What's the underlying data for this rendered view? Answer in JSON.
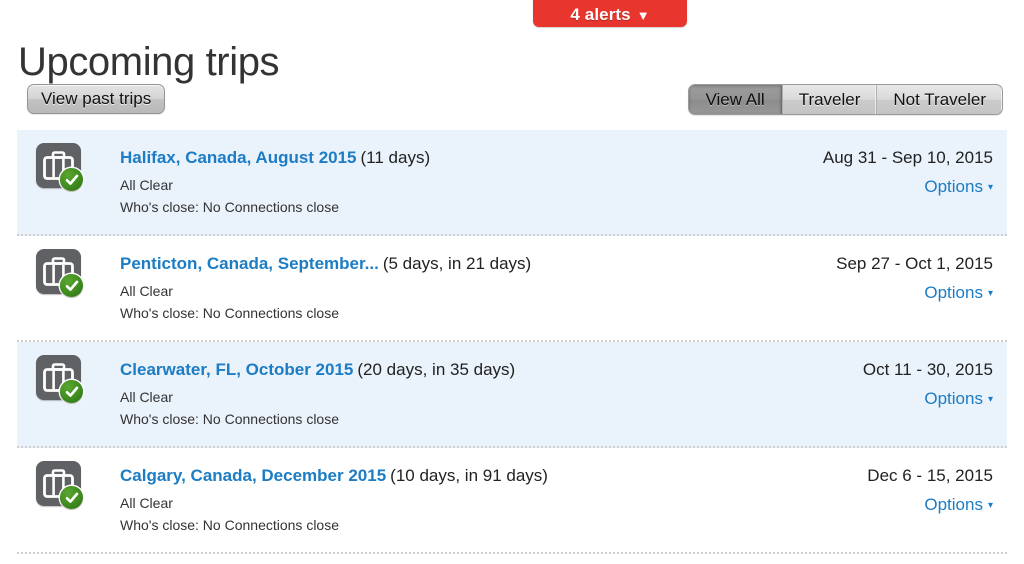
{
  "header": {
    "title": "Upcoming trips",
    "alerts_badge": {
      "label": "4 alerts",
      "caret": "▼",
      "color": "#e8362f"
    },
    "view_past_trips_label": "View past trips",
    "filters": {
      "selected": "View All",
      "options": [
        "View All",
        "Traveler",
        "Not Traveler"
      ]
    }
  },
  "trips": [
    {
      "title": "Halifax, Canada, August 2015",
      "duration": "(11 days)",
      "status": "All Clear",
      "whos_close": "Who's close: No Connections close",
      "dates": "Aug 31 - Sep 10, 2015",
      "options_label": "Options",
      "options_caret": "▾",
      "icon": "briefcase-icon",
      "badge": "green-check-icon",
      "shaded": true
    },
    {
      "title": "Penticton, Canada, September...",
      "duration": "(5 days, in 21 days)",
      "status": "All Clear",
      "whos_close": "Who's close: No Connections close",
      "dates": "Sep 27 - Oct 1, 2015",
      "options_label": "Options",
      "options_caret": "▾",
      "icon": "briefcase-icon",
      "badge": "green-check-icon",
      "shaded": false
    },
    {
      "title": "Clearwater, FL, October 2015",
      "duration": "(20 days, in 35 days)",
      "status": "All Clear",
      "whos_close": "Who's close: No Connections close",
      "dates": "Oct 11 - 30, 2015",
      "options_label": "Options",
      "options_caret": "▾",
      "icon": "briefcase-icon",
      "badge": "green-check-icon",
      "shaded": true
    },
    {
      "title": "Calgary, Canada, December 2015",
      "duration": "(10 days, in 91 days)",
      "status": "All Clear",
      "whos_close": "Who's close: No Connections close",
      "dates": "Dec 6 - 15, 2015",
      "options_label": "Options",
      "options_caret": "▾",
      "icon": "briefcase-icon",
      "badge": "green-check-icon",
      "shaded": false
    }
  ],
  "colors": {
    "link": "#1c7cc4",
    "row_highlight": "#eaf2fb",
    "alert_red": "#e8362f",
    "icon_gray": "#5f6164",
    "badge_green": "#3f8c1f"
  }
}
